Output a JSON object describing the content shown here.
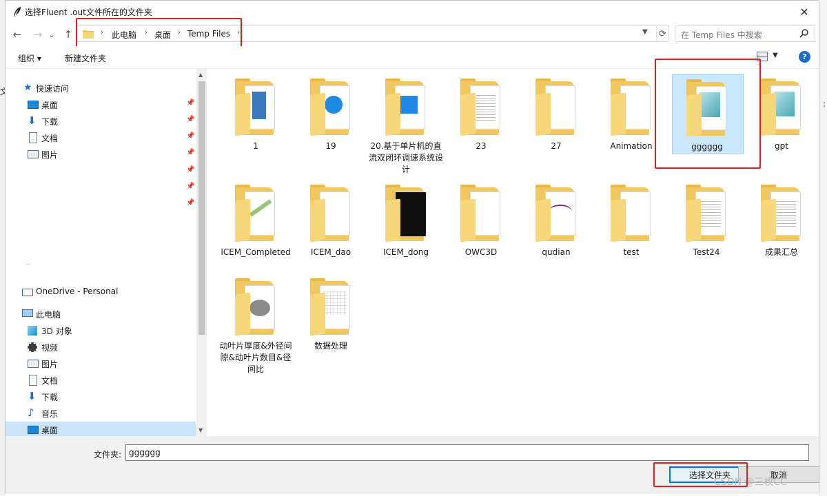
{
  "window": {
    "title": "选择Fluent .out文件所在的文件夹"
  },
  "nav_buttons": {
    "back": "←",
    "forward": "→",
    "dropdown": "⌄",
    "up": "↑"
  },
  "address": {
    "crumbs": [
      "此电脑",
      "桌面",
      "Temp Files"
    ],
    "separator": "›",
    "search_placeholder": "在 Temp Files 中搜索"
  },
  "toolbar": {
    "organize": "组织 ▾",
    "new_folder": "新建文件夹"
  },
  "sidebar": {
    "quick_access": "快速访问",
    "quick_items": [
      {
        "label": "桌面",
        "icon": "desktop-icon"
      },
      {
        "label": "下载",
        "icon": "download-icon"
      },
      {
        "label": "文档",
        "icon": "documents-icon"
      },
      {
        "label": "图片",
        "icon": "pictures-icon"
      }
    ],
    "onedrive": "OneDrive - Personal",
    "this_pc": "此电脑",
    "pc_items": [
      {
        "label": "3D 对象",
        "icon": "3d-objects-icon"
      },
      {
        "label": "视频",
        "icon": "videos-icon"
      },
      {
        "label": "图片",
        "icon": "pictures-icon"
      },
      {
        "label": "文档",
        "icon": "documents-icon"
      },
      {
        "label": "下载",
        "icon": "download-icon"
      },
      {
        "label": "音乐",
        "icon": "music-icon"
      },
      {
        "label": "桌面",
        "icon": "desktop-icon",
        "selected": true
      }
    ]
  },
  "folders": [
    {
      "name": "1"
    },
    {
      "name": "19"
    },
    {
      "name": "20.基于单片机的直流双闭环调速系统设计"
    },
    {
      "name": "23"
    },
    {
      "name": "27"
    },
    {
      "name": "Animation"
    },
    {
      "name": "gggggg",
      "selected": true
    },
    {
      "name": "gpt"
    },
    {
      "name": "ICEM_Completed"
    },
    {
      "name": "ICEM_dao"
    },
    {
      "name": "ICEM_dong"
    },
    {
      "name": "OWC3D"
    },
    {
      "name": "qudian"
    },
    {
      "name": "test"
    },
    {
      "name": "Test24"
    },
    {
      "name": "成果汇总"
    },
    {
      "name": "动叶片厚度&外径间隙&动叶片数目&径间比"
    },
    {
      "name": "数据处理"
    }
  ],
  "footer": {
    "folder_label": "文件夹:",
    "folder_value": "gggggg",
    "select_button": "选择文件夹",
    "cancel_button": "取消"
  },
  "background": {
    "left_char": "文",
    "right_char": ":"
  },
  "watermark": "CSDN @三枚CC",
  "colors": {
    "accent": "#0078d7",
    "selection": "#cce8ff",
    "highlight_box": "#e01d1d",
    "folder": "#f0c75e"
  }
}
